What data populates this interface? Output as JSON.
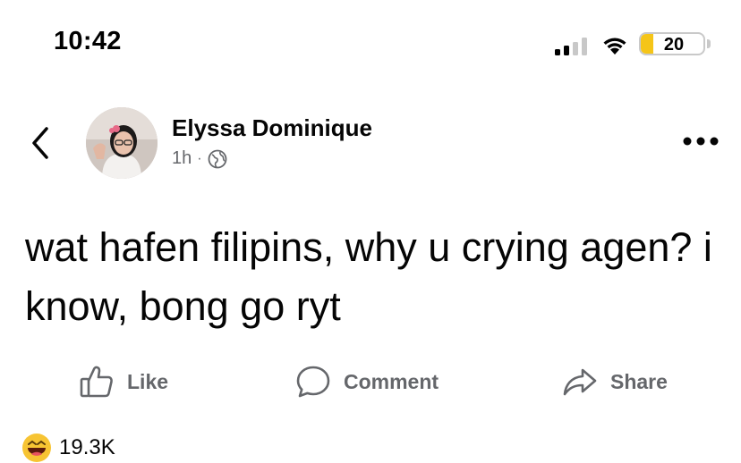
{
  "status_bar": {
    "time": "10:42",
    "battery": "20",
    "battery_level_percent": 20,
    "battery_color": "#f5c518"
  },
  "post": {
    "author": "Elyssa Dominique",
    "time": "1h",
    "separator": "·",
    "privacy_icon": "globe-icon",
    "text": "wat hafen filipins, why u crying agen? i know, bong go ryt"
  },
  "actions": {
    "like_label": "Like",
    "comment_label": "Comment",
    "share_label": "Share"
  },
  "reactions": {
    "icon": "laughing-emoji-icon",
    "count": "19.3K"
  }
}
